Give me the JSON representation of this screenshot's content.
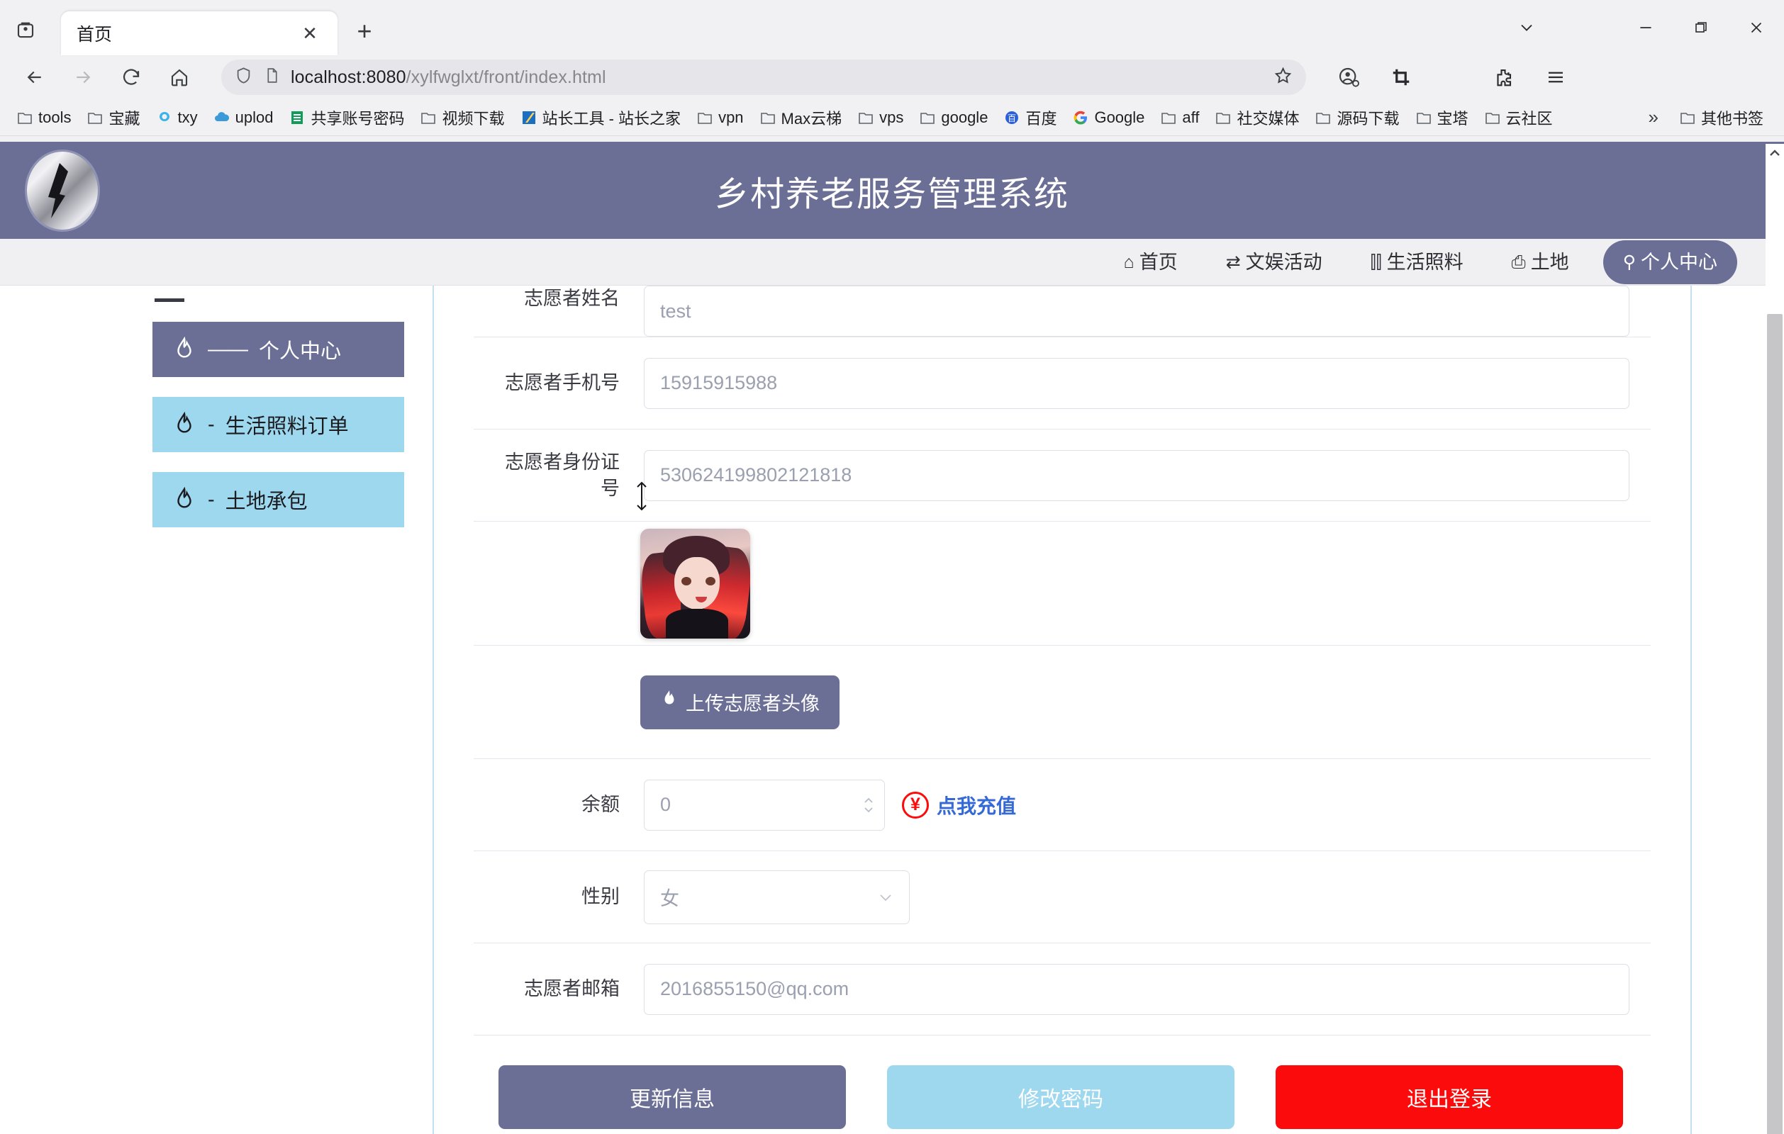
{
  "browser": {
    "tab": {
      "title": "首页",
      "close_label": "✕"
    },
    "new_tab_label": "+",
    "url": {
      "host": "localhost:8080",
      "path": "/xylfwglxt/front/index.html",
      "full": "localhost:8080/xylfwglxt/front/index.html"
    },
    "window_controls": {
      "chevron": "⌄",
      "minimize": "—",
      "maximize": "❐",
      "close": "✕"
    },
    "bookmarks": [
      {
        "label": "tools",
        "icon": "folder-icon"
      },
      {
        "label": "宝藏",
        "icon": "folder-icon"
      },
      {
        "label": "txy",
        "icon": "tencent-cloud-icon"
      },
      {
        "label": "uplod",
        "icon": "cloud-upload-icon"
      },
      {
        "label": "共享账号密码",
        "icon": "sheets-icon"
      },
      {
        "label": "视频下载",
        "icon": "folder-icon"
      },
      {
        "label": "站长工具 - 站长之家",
        "icon": "chinaz-icon"
      },
      {
        "label": "vpn",
        "icon": "folder-icon"
      },
      {
        "label": "Max云梯",
        "icon": "folder-icon"
      },
      {
        "label": "vps",
        "icon": "folder-icon"
      },
      {
        "label": "google",
        "icon": "folder-icon"
      },
      {
        "label": "百度",
        "icon": "baidu-icon"
      },
      {
        "label": "Google",
        "icon": "google-icon"
      },
      {
        "label": "aff",
        "icon": "folder-icon"
      },
      {
        "label": "社交媒体",
        "icon": "folder-icon"
      },
      {
        "label": "源码下载",
        "icon": "folder-icon"
      },
      {
        "label": "宝塔",
        "icon": "folder-icon"
      },
      {
        "label": "云社区",
        "icon": "folder-icon"
      }
    ],
    "bookmarks_overflow": "»",
    "other_bookmarks": {
      "label": "其他书签",
      "icon": "folder-icon"
    }
  },
  "site": {
    "title": "乡村养老服务管理系统",
    "nav": [
      {
        "label": "首页",
        "glyph": "⌂",
        "icon": "home-icon",
        "active": false
      },
      {
        "label": "文娱活动",
        "glyph": "⇄",
        "icon": "activity-icon",
        "active": false
      },
      {
        "label": "生活照料",
        "glyph": "⫿⫿",
        "icon": "care-icon",
        "active": false
      },
      {
        "label": "土地",
        "glyph": "⎙",
        "icon": "land-icon",
        "active": false
      },
      {
        "label": "个人中心",
        "glyph": "⚲",
        "icon": "user-icon",
        "active": true
      }
    ]
  },
  "sidebar": {
    "items": [
      {
        "label": "个人中心",
        "sep": "——",
        "active": true
      },
      {
        "label": "生活照料订单",
        "sep": "-",
        "active": false
      },
      {
        "label": "土地承包",
        "sep": "-",
        "active": false
      }
    ]
  },
  "form": {
    "rows": [
      {
        "label": "志愿者姓名",
        "value": "test",
        "type": "text-cut"
      },
      {
        "label": "志愿者手机号",
        "value": "15915915988",
        "type": "text"
      },
      {
        "label": "志愿者身份证号",
        "value": "530624199802121818",
        "type": "text"
      }
    ],
    "avatar": {
      "label": "",
      "alt": "志愿者头像"
    },
    "upload_button": {
      "label": "上传志愿者头像",
      "icon": "upload-flame-icon"
    },
    "balance": {
      "label": "余额",
      "value": "0",
      "recharge_label": "点我充值",
      "currency_symbol": "¥"
    },
    "gender": {
      "label": "性别",
      "value": "女",
      "caret": "⌄"
    },
    "email": {
      "label": "志愿者邮箱",
      "value": "2016855150@qq.com"
    }
  },
  "actions": {
    "update": "更新信息",
    "change_password": "修改密码",
    "logout": "退出登录"
  },
  "colors": {
    "brand_purple": "#6b6f96",
    "light_blue": "#9ed8ef",
    "danger_red": "#fb0b0b",
    "link_blue": "#3569d6"
  }
}
